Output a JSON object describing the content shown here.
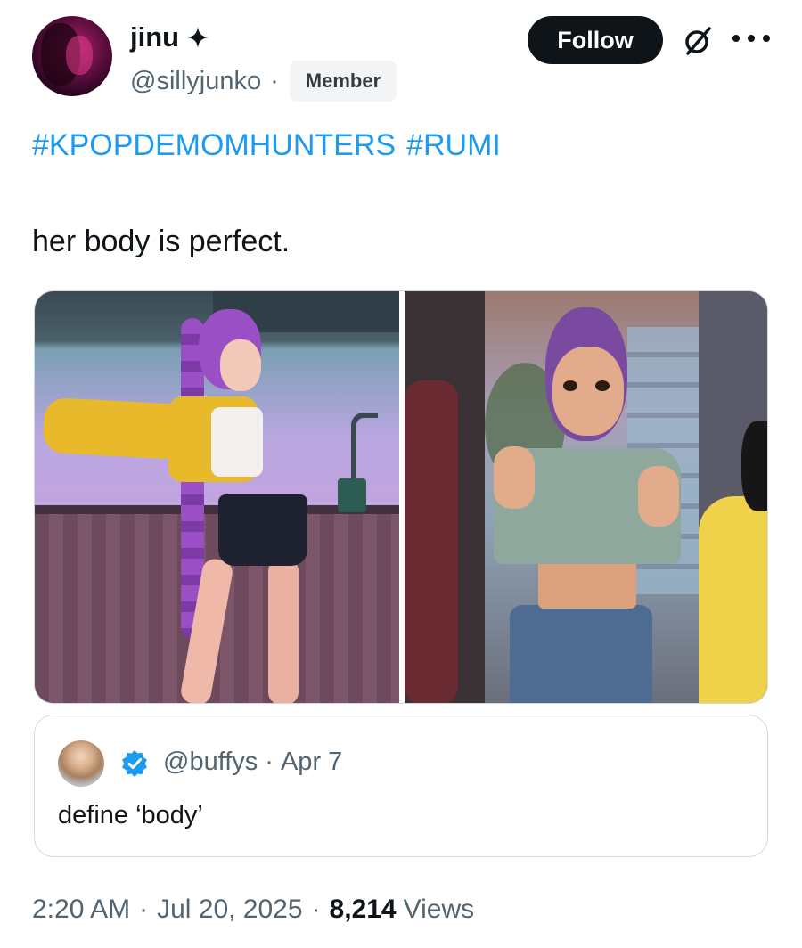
{
  "author": {
    "display_name": "jinu",
    "handle": "@sillyjunko",
    "handle_separator": "·",
    "badge": "Member",
    "avatar_icon": "avatar-image",
    "name_icon": "sparkle-icon"
  },
  "actions": {
    "follow_label": "Follow",
    "grok_icon": "grok-slash-icon",
    "more_icon": "more-dots-icon"
  },
  "post": {
    "hashtags": [
      "#KPOPDEMOMHUNTERS",
      "#RUMI"
    ],
    "text": "her body is perfect."
  },
  "quote": {
    "handle": "@buffys",
    "separator": "·",
    "date": "Apr 7",
    "text": "define ‘body’",
    "verified_icon": "verified-badge-icon",
    "verified_color": "#1d9bf0"
  },
  "footer": {
    "time": "2:20 AM",
    "sep1": "·",
    "date": "Jul 20, 2025",
    "sep2": "·",
    "views_count": "8,214",
    "views_label": "Views"
  },
  "colors": {
    "link": "#1d9bf0",
    "muted": "#536471",
    "text": "#0f1419",
    "button": "#0f1419"
  }
}
